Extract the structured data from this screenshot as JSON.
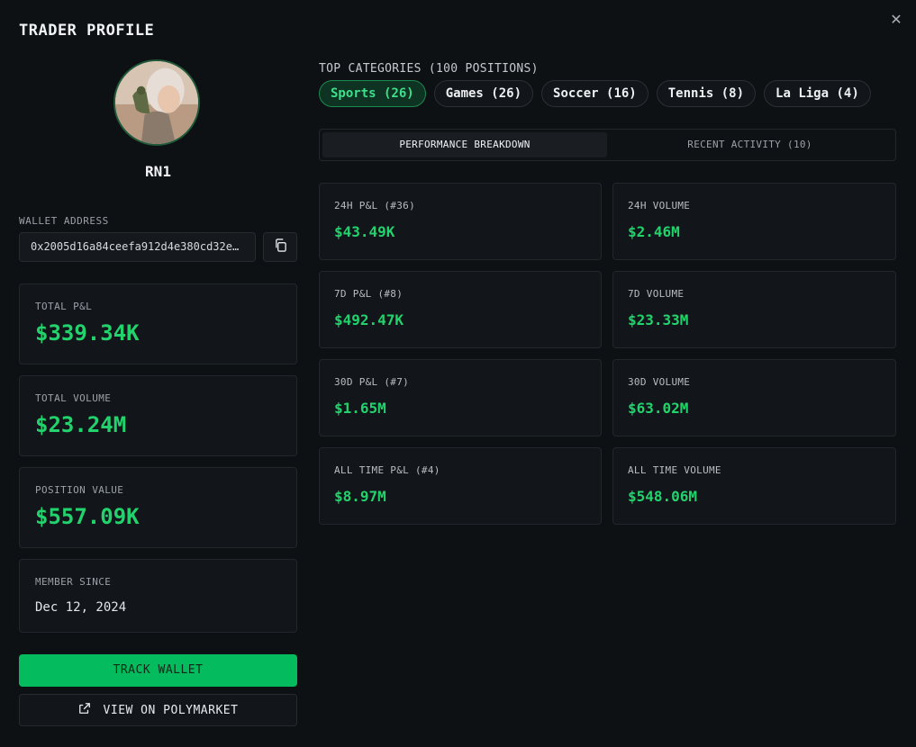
{
  "header": {
    "title": "TRADER PROFILE",
    "close_glyph": "✕"
  },
  "profile": {
    "username": "RN1",
    "wallet_label": "WALLET ADDRESS",
    "wallet_address": "0x2005d16a84ceefa912d4e380cd32e…"
  },
  "stats": {
    "total_pnl": {
      "label": "TOTAL P&L",
      "value": "$339.34K"
    },
    "total_volume": {
      "label": "TOTAL VOLUME",
      "value": "$23.24M"
    },
    "position_value": {
      "label": "POSITION VALUE",
      "value": "$557.09K"
    },
    "member_since": {
      "label": "MEMBER SINCE",
      "value": "Dec 12, 2024"
    }
  },
  "actions": {
    "track_label": "TRACK WALLET",
    "polymarket_label": "VIEW ON POLYMARKET"
  },
  "categories": {
    "label": "TOP CATEGORIES (100 POSITIONS)",
    "chips": [
      "Sports (26)",
      "Games (26)",
      "Soccer (16)",
      "Tennis (8)",
      "La Liga (4)"
    ]
  },
  "tabs": [
    "PERFORMANCE BREAKDOWN",
    "RECENT ACTIVITY (10)"
  ],
  "performance": [
    {
      "label": "24H P&L (#36)",
      "value": "$43.49K"
    },
    {
      "label": "24H VOLUME",
      "value": "$2.46M"
    },
    {
      "label": "7D P&L (#8)",
      "value": "$492.47K"
    },
    {
      "label": "7D VOLUME",
      "value": "$23.33M"
    },
    {
      "label": "30D P&L (#7)",
      "value": "$1.65M"
    },
    {
      "label": "30D VOLUME",
      "value": "$63.02M"
    },
    {
      "label": "ALL TIME P&L (#4)",
      "value": "$8.97M"
    },
    {
      "label": "ALL TIME VOLUME",
      "value": "$548.06M"
    }
  ],
  "colors": {
    "accent": "#22d36d",
    "button": "#04bb5d",
    "background": "#0e1114"
  },
  "icons": {
    "close": "close-icon",
    "copy": "copy-icon",
    "external": "external-link-icon"
  }
}
